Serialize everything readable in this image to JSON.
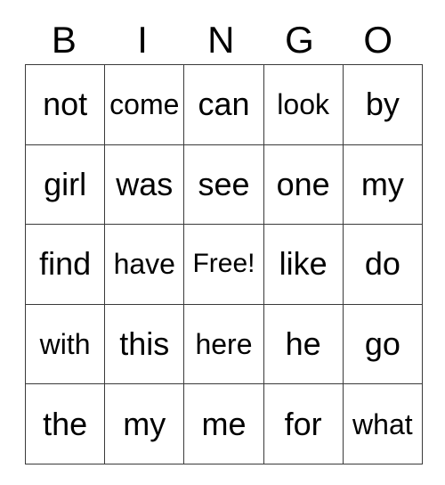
{
  "card": {
    "title": "BINGO",
    "free_space_label": "Free!",
    "headers": [
      "B",
      "I",
      "N",
      "G",
      "O"
    ],
    "grid_border_color": "#3a3a3a",
    "background_color": "#ffffff",
    "text_color": "#000000",
    "rows": [
      [
        {
          "text": "not",
          "size": "lg"
        },
        {
          "text": "come",
          "size": "sm"
        },
        {
          "text": "can",
          "size": "lg"
        },
        {
          "text": "look",
          "size": "sm"
        },
        {
          "text": "by",
          "size": "lg"
        }
      ],
      [
        {
          "text": "girl",
          "size": "lg"
        },
        {
          "text": "was",
          "size": "lg"
        },
        {
          "text": "see",
          "size": "lg"
        },
        {
          "text": "one",
          "size": "lg"
        },
        {
          "text": "my",
          "size": "lg"
        }
      ],
      [
        {
          "text": "find",
          "size": "lg"
        },
        {
          "text": "have",
          "size": "sm"
        },
        {
          "text": "Free!",
          "size": "xs"
        },
        {
          "text": "like",
          "size": "lg"
        },
        {
          "text": "do",
          "size": "lg"
        }
      ],
      [
        {
          "text": "with",
          "size": "sm"
        },
        {
          "text": "this",
          "size": "lg"
        },
        {
          "text": "here",
          "size": "sm"
        },
        {
          "text": "he",
          "size": "lg"
        },
        {
          "text": "go",
          "size": "lg"
        }
      ],
      [
        {
          "text": "the",
          "size": "lg"
        },
        {
          "text": "my",
          "size": "lg"
        },
        {
          "text": "me",
          "size": "lg"
        },
        {
          "text": "for",
          "size": "lg"
        },
        {
          "text": "what",
          "size": "sm"
        }
      ]
    ]
  }
}
